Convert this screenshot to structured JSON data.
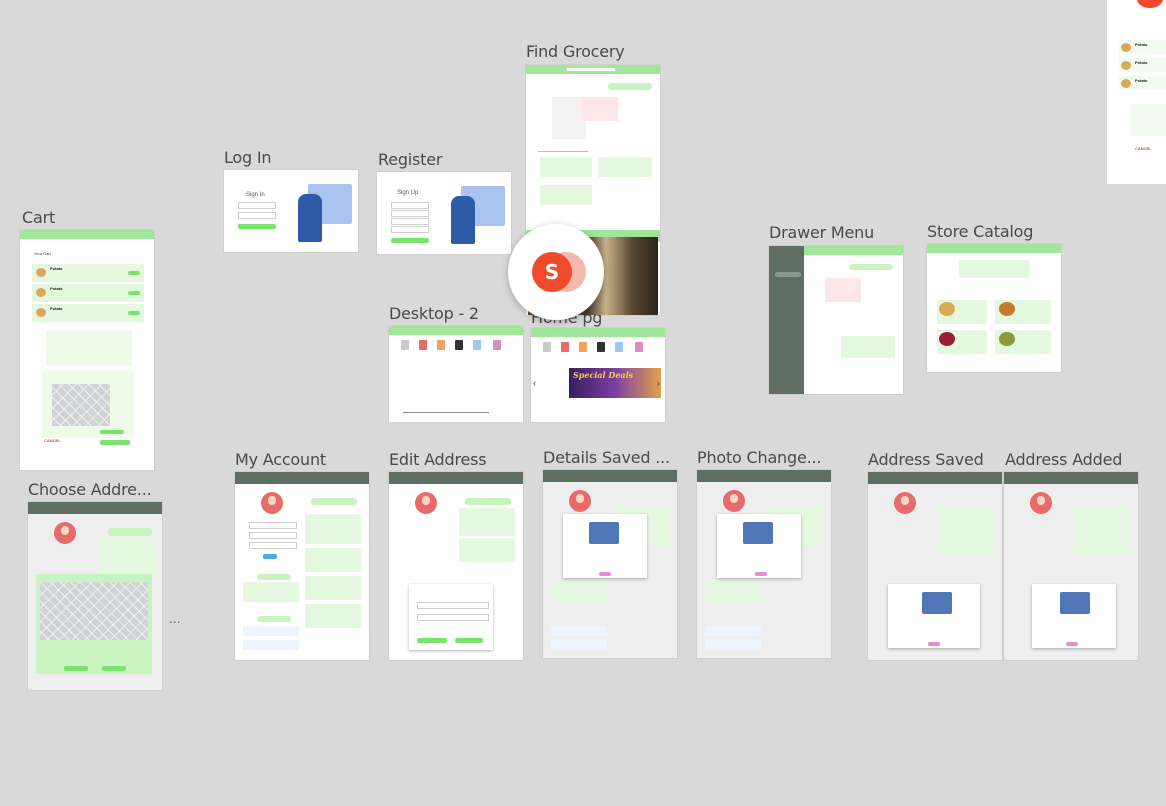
{
  "canvas_background": "#d9d9d9",
  "accent_green": "#79e36d",
  "frames": {
    "find_grocery": {
      "label": "Find Grocery"
    },
    "log_in": {
      "label": "Log In"
    },
    "register": {
      "label": "Register"
    },
    "cart": {
      "label": "Cart"
    },
    "drawer_menu": {
      "label": "Drawer Menu"
    },
    "store_catalog": {
      "label": "Store Catalog"
    },
    "desktop_2": {
      "label": "Desktop - 2"
    },
    "home_pg": {
      "label": "Home pg"
    },
    "choose_address": {
      "label": "Choose Addre..."
    },
    "my_account": {
      "label": "My Account"
    },
    "edit_address": {
      "label": "Edit Address"
    },
    "details_saved": {
      "label": "Details Saved ..."
    },
    "photo_change": {
      "label": "Photo Change..."
    },
    "address_saved": {
      "label": "Address Saved"
    },
    "address_added": {
      "label": "Address Added"
    }
  },
  "mini_text": {
    "sign_in": "Sign In",
    "sign_up": "Sign Up",
    "your_cart": "Your Cart",
    "potato": "Potato",
    "special_deals": "Special Deals",
    "cancel": "CANCEL"
  },
  "ellipsis": "...",
  "plugin_badge": {
    "letter": "S",
    "icon": "plugin-logo-icon"
  }
}
